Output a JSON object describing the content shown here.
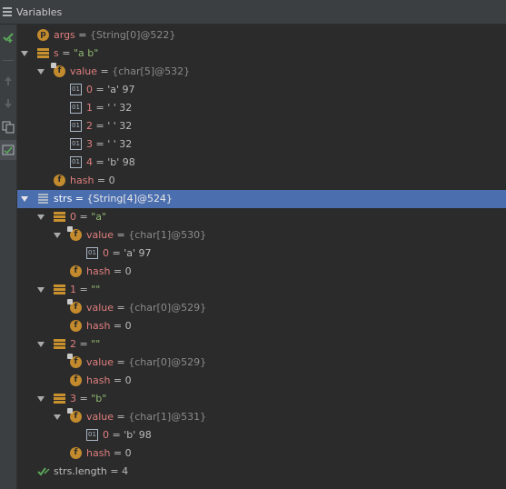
{
  "panel": {
    "title": "Variables"
  },
  "rows": [
    {
      "name": "args",
      "eq": " = ",
      "meta": "{String[0]@522}",
      "val": ""
    },
    {
      "name": "s",
      "eq": " = ",
      "meta": "",
      "val": "\"a  b\""
    },
    {
      "name": "value",
      "eq": " = ",
      "meta": "{char[5]@532}",
      "val": ""
    },
    {
      "name": "0",
      "eq": " = ",
      "meta": "",
      "val": "'a' 97"
    },
    {
      "name": "1",
      "eq": " = ",
      "meta": "",
      "val": "' ' 32"
    },
    {
      "name": "2",
      "eq": " = ",
      "meta": "",
      "val": "' ' 32"
    },
    {
      "name": "3",
      "eq": " = ",
      "meta": "",
      "val": "' ' 32"
    },
    {
      "name": "4",
      "eq": " = ",
      "meta": "",
      "val": "'b' 98"
    },
    {
      "name": "hash",
      "eq": " = ",
      "meta": "",
      "val": "0"
    },
    {
      "name": "strs",
      "eq": " = ",
      "meta": "{String[4]@524}",
      "val": ""
    },
    {
      "name": "0",
      "eq": " = ",
      "meta": "",
      "val": "\"a\""
    },
    {
      "name": "value",
      "eq": " = ",
      "meta": "{char[1]@530}",
      "val": ""
    },
    {
      "name": "0",
      "eq": " = ",
      "meta": "",
      "val": "'a' 97"
    },
    {
      "name": "hash",
      "eq": " = ",
      "meta": "",
      "val": "0"
    },
    {
      "name": "1",
      "eq": " = ",
      "meta": "",
      "val": "\"\""
    },
    {
      "name": "value",
      "eq": " = ",
      "meta": "{char[0]@529}",
      "val": ""
    },
    {
      "name": "hash",
      "eq": " = ",
      "meta": "",
      "val": "0"
    },
    {
      "name": "2",
      "eq": " = ",
      "meta": "",
      "val": "\"\""
    },
    {
      "name": "value",
      "eq": " = ",
      "meta": "{char[0]@529}",
      "val": ""
    },
    {
      "name": "hash",
      "eq": " = ",
      "meta": "",
      "val": "0"
    },
    {
      "name": "3",
      "eq": " = ",
      "meta": "",
      "val": "\"b\""
    },
    {
      "name": "value",
      "eq": " = ",
      "meta": "{char[1]@531}",
      "val": ""
    },
    {
      "name": "0",
      "eq": " = ",
      "meta": "",
      "val": "'b' 98"
    },
    {
      "name": "hash",
      "eq": " = ",
      "meta": "",
      "val": "0"
    },
    {
      "name": "strs.length",
      "eq": " = ",
      "meta": "",
      "val": "4"
    }
  ],
  "colors": {
    "selection": "#4b6eaf",
    "field_name": "#e07e7e",
    "string_value": "#8fb771",
    "icon_orange": "#c38b2d"
  }
}
